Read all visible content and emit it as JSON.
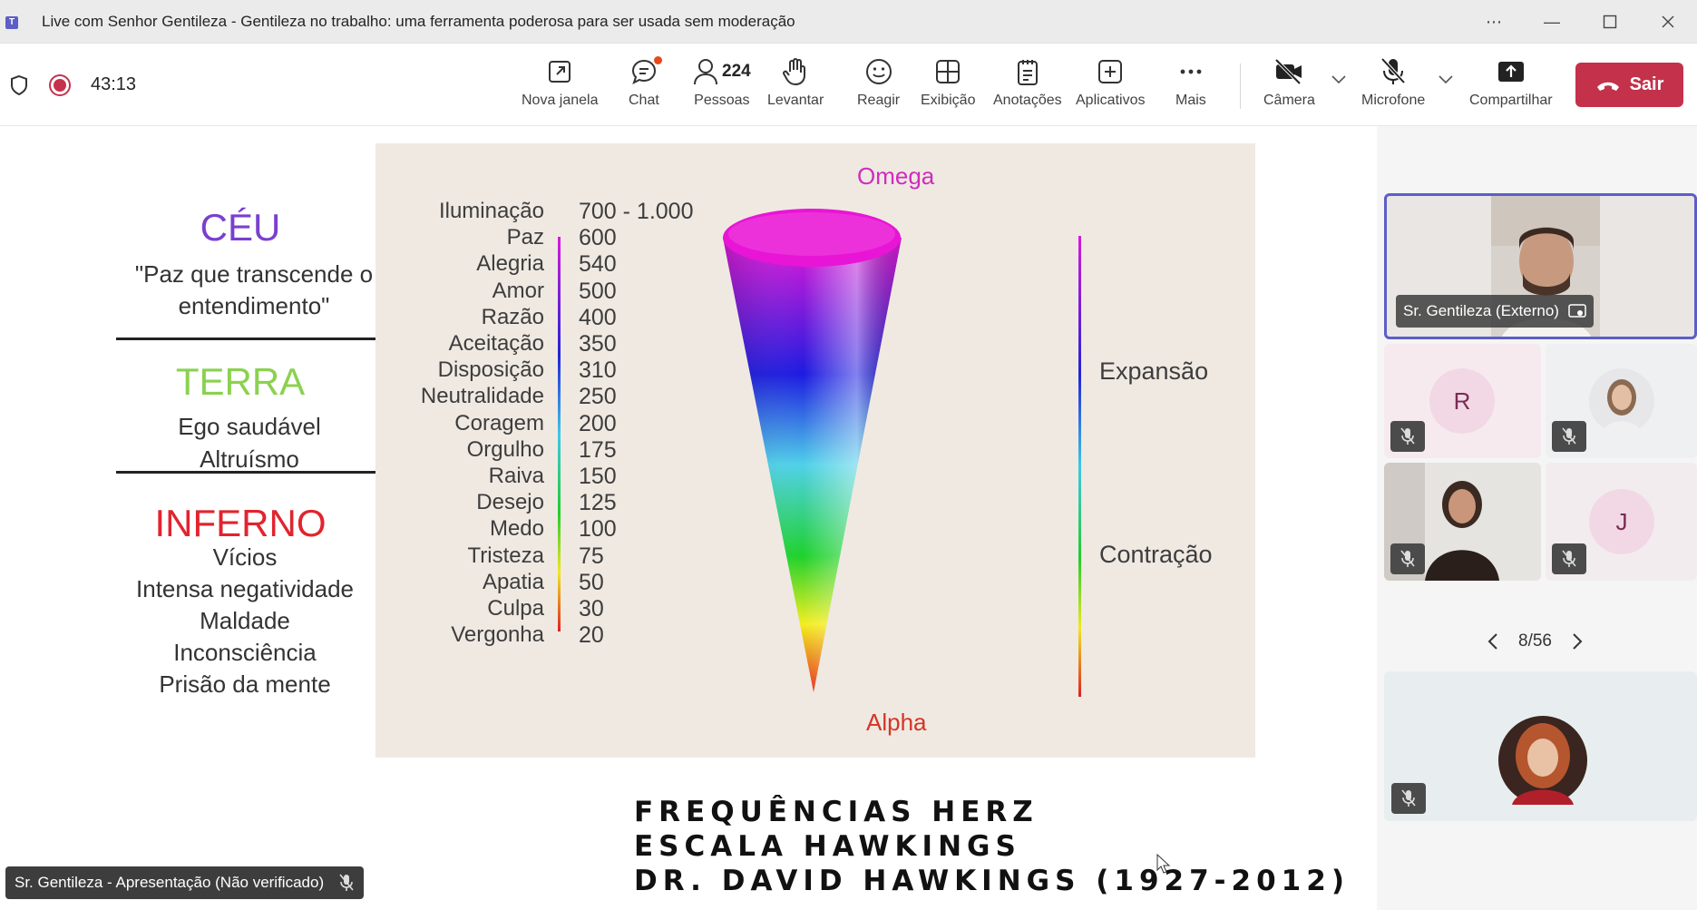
{
  "window": {
    "title": "Live com Senhor Gentileza - Gentileza no trabalho: uma ferramenta poderosa para ser usada sem moderação",
    "more_icon": "more-icon",
    "minimize_icon": "minimize-icon",
    "maximize_icon": "maximize-icon",
    "close_icon": "close-icon"
  },
  "toolbar": {
    "timer": "43:13",
    "items": {
      "nova_janela": "Nova janela",
      "chat": "Chat",
      "pessoas": "Pessoas",
      "pessoas_count": "224",
      "levantar": "Levantar",
      "reagir": "Reagir",
      "exibicao": "Exibição",
      "anotacoes": "Anotações",
      "aplicativos": "Aplicativos",
      "mais": "Mais",
      "camera": "Câmera",
      "microfone": "Microfone",
      "compartilhar": "Compartilhar"
    },
    "leave_label": "Sair",
    "colors": {
      "leave": "#c4314b",
      "record": "#c4314b",
      "accent": "#5b5fc7"
    }
  },
  "slide": {
    "ceu": {
      "title": "CÉU",
      "line1": "\"Paz que transcende o",
      "line2": "entendimento\""
    },
    "terra": {
      "title": "TERRA",
      "line1": "Ego saudável",
      "line2": "Altruísmo"
    },
    "inferno": {
      "title": "INFERNO",
      "lines": [
        "Vícios",
        "Intensa negatividade",
        "Maldade",
        "Inconsciência",
        "Prisão da mente"
      ]
    },
    "scale": [
      {
        "name": "Iluminação",
        "value": "700 - 1.000"
      },
      {
        "name": "Paz",
        "value": "600"
      },
      {
        "name": "Alegria",
        "value": "540"
      },
      {
        "name": "Amor",
        "value": "500"
      },
      {
        "name": "Razão",
        "value": "400"
      },
      {
        "name": "Aceitação",
        "value": "350"
      },
      {
        "name": "Disposição",
        "value": "310"
      },
      {
        "name": "Neutralidade",
        "value": "250"
      },
      {
        "name": "Coragem",
        "value": "200"
      },
      {
        "name": "Orgulho",
        "value": "175"
      },
      {
        "name": "Raiva",
        "value": "150"
      },
      {
        "name": "Desejo",
        "value": "125"
      },
      {
        "name": "Medo",
        "value": "100"
      },
      {
        "name": "Tristeza",
        "value": "75"
      },
      {
        "name": "Apatia",
        "value": "50"
      },
      {
        "name": "Culpa",
        "value": "30"
      },
      {
        "name": "Vergonha",
        "value": "20"
      }
    ],
    "omega": "Omega",
    "alpha": "Alpha",
    "expansao": "Expansão",
    "contracao": "Contração",
    "caption1": "FREQUÊNCIAS HERZ",
    "caption2": "ESCALA HAWKINGS",
    "caption3": "DR. DAVID HAWKINGS (1927-2012)"
  },
  "presenter": {
    "label": "Sr. Gentileza - Apresentação (Não verificado)"
  },
  "participants": {
    "main": "Sr. Gentileza (Externo)",
    "r_initial": "R",
    "j_initial": "J",
    "pager": "8/56"
  }
}
